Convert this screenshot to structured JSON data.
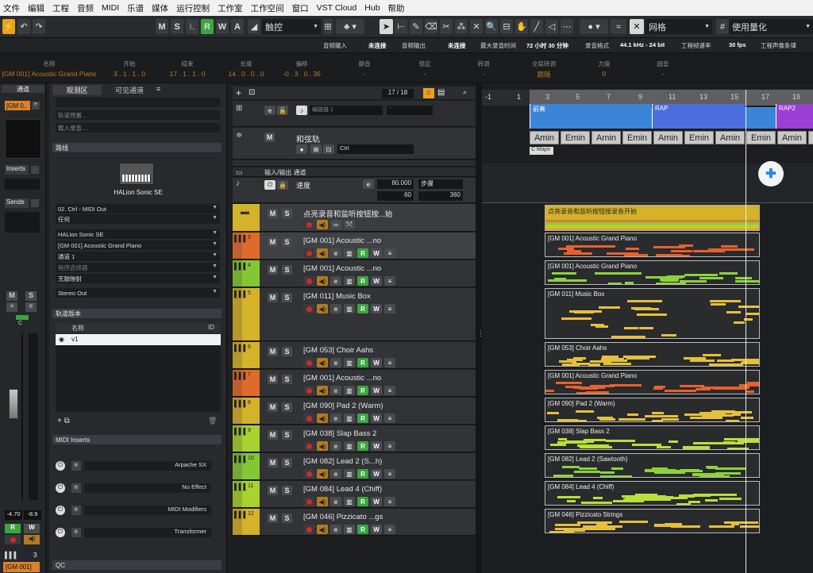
{
  "menu": [
    "文件",
    "编辑",
    "工程",
    "音频",
    "MIDI",
    "乐谱",
    "媒体",
    "运行控制",
    "工作室",
    "工作空间",
    "窗口",
    "VST Cloud",
    "Hub",
    "帮助"
  ],
  "toolbar": {
    "ms": [
      "M",
      "S",
      "L",
      "R",
      "W",
      "A"
    ],
    "touch": "触控",
    "grid": "网格",
    "quantize": "使用量化"
  },
  "status": {
    "audio_in_label": "音频输入",
    "audio_in_value": "未连接",
    "audio_out_label": "音频输出",
    "audio_out_value": "未连接",
    "max_rec_label": "最大录音时间",
    "max_rec_value": "72 小时 30 分钟",
    "rec_format_label": "录音格式",
    "rec_format_value": "44.1 kHz - 24 bit",
    "frame_label": "工程帧速率",
    "frame_value": "30 fps",
    "pan_label": "工程声像条律"
  },
  "infoline": {
    "headers": [
      "名称",
      "开始",
      "结束",
      "长度",
      "偏移",
      "静音",
      "锁定",
      "转调",
      "全局转调",
      "力度",
      "固音"
    ],
    "values": [
      "[GM 001] Acoustic Grand Piano",
      "3 . 1 . 1 .    0",
      "17 . 1 . 1 .    0",
      "14 . 0 . 0 .    0",
      "-0 . 3 . 0 . 36",
      "-",
      "-",
      "-",
      "跟随",
      "0",
      "-"
    ]
  },
  "inspector_col": {
    "track_label": "[GM 0..",
    "inserts": "Inserts",
    "sends": "Sends",
    "vol": "-4.70",
    "pan": "-8.9",
    "bottom_num": "3",
    "bottom_label": "[GM 001]",
    "c": "C"
  },
  "inspector": {
    "tabs": [
      "通道",
      "观测区",
      "可见通道"
    ],
    "top_rows": [
      "轨道预置...",
      "载入录音..."
    ],
    "routing_label": "路线",
    "instrument": "HALion Sonic SE",
    "rows": [
      "02. Ctrl - MIDI Out",
      "任何",
      "HALion Sonic SE",
      "[GM 001] Acoustic Grand Piano",
      "通道 1",
      "程序选择器",
      "无鼓映射",
      "Stereo Out"
    ],
    "version_label": "轨道版本",
    "version_cols": [
      "名称",
      "ID"
    ],
    "version_row": "v1",
    "midi_inserts": "MIDI Inserts",
    "inserts": [
      "Arpache SX",
      "No Effect",
      "MIDI Modifiers",
      "Transformer"
    ],
    "qc": "QC"
  },
  "trackhead": {
    "counter": "17 / 18",
    "chain": "编链链 1",
    "chord_track": "和弦轨",
    "chord_sel": "Ctrl",
    "io_label": "输入/输出 通道",
    "tempo_label": "速度",
    "tempo": "80.000",
    "step": "步骤",
    "sig_a": "60",
    "sig_b": "360",
    "folder_name": "点亮录音和监听按钮按...始"
  },
  "tracks": [
    {
      "num": "3",
      "name": "[GM 001] Acoustic ...no",
      "color": "#e06a2a",
      "clip": "[GM 001] Acoustic Grand Piano",
      "nc": "#e8612c"
    },
    {
      "num": "4",
      "name": "[GM 001] Acoustic ...no",
      "color": "#83c834",
      "clip": "[GM 001] Acoustic Grand Piano",
      "nc": "#8ad43a"
    },
    {
      "num": "5",
      "name": "[GM 011] Music Box",
      "color": "#d4b22a",
      "clip": "[GM 011] Music Box",
      "nc": "#e6c03a"
    },
    {
      "num": "6",
      "name": "[GM 053] Choir Aahs",
      "color": "#d4b22a",
      "clip": "[GM 053] Choir Aahs",
      "nc": "#e6c03a"
    },
    {
      "num": "7",
      "name": "[GM 001] Acoustic ...no",
      "color": "#e06a2a",
      "clip": "[GM 001] Acoustic Grand Piano",
      "nc": "#e8612c"
    },
    {
      "num": "8",
      "name": "[GM 090] Pad 2 (Warm)",
      "color": "#d4b22a",
      "clip": "[GM 090] Pad 2 (Warm)",
      "nc": "#e6c03a"
    },
    {
      "num": "9",
      "name": "[GM 038] Slap Bass 2",
      "color": "#a8d22e",
      "clip": "[GM 038] Slap Bass 2",
      "nc": "#b8e03a"
    },
    {
      "num": "10",
      "name": "[GM 082] Lead 2 (S...h)",
      "color": "#83c834",
      "clip": "[GM 082] Lead 2 (Sawtooth)",
      "nc": "#8ad43a"
    },
    {
      "num": "11",
      "name": "[GM 084] Lead 4 (Chiff)",
      "color": "#a8d22e",
      "clip": "[GM 084] Lead 4 (Chiff)",
      "nc": "#b8e03a"
    },
    {
      "num": "12",
      "name": "[GM 046] Pizzicato ...gs",
      "color": "#d4b22a",
      "clip": "[GM 046] Pizzicato Strings",
      "nc": "#e6c03a"
    }
  ],
  "arrange": {
    "ruler": [
      "-1",
      "1",
      "3",
      "5",
      "7",
      "9",
      "11",
      "13",
      "15",
      "17",
      "19"
    ],
    "markers": [
      "前奏",
      "RAP",
      "RAP2"
    ],
    "chords": [
      "Amin",
      "Emin",
      "Amin",
      "Emin",
      "Amin",
      "Emin",
      "Amin",
      "Emin",
      "Amin",
      "Emin"
    ],
    "key": "C Major",
    "folder_clip": "点亮录音和监听按钮按录音开始"
  },
  "colors": {
    "accent": "#f0a11c",
    "rw": "#3aa640"
  }
}
